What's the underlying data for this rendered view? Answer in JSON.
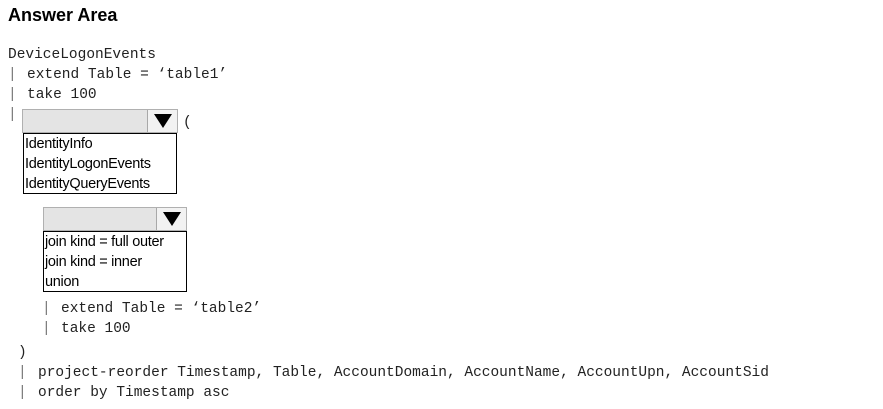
{
  "heading": "Answer Area",
  "query": {
    "source_table": "DeviceLogonEvents",
    "pipe_symbol": "|",
    "line_extend_1": "extend Table = ‘table1’",
    "line_take_1": "take 100",
    "open_paren": "(",
    "line_extend_2": "extend Table = ‘table2’",
    "line_take_2": "take 100",
    "close_paren": ")",
    "line_project": "project-reorder Timestamp, Table, AccountDomain, AccountName, AccountUpn, AccountSid",
    "line_order": "order by Timestamp asc"
  },
  "dropdown_table": {
    "selected": "",
    "arrow_icon": "triangle-down-icon",
    "options": [
      "IdentityInfo",
      "IdentityLogonEvents",
      "IdentityQueryEvents"
    ]
  },
  "dropdown_operator": {
    "selected": "",
    "arrow_icon": "triangle-down-icon",
    "options": [
      "join kind = full outer",
      "join kind = inner",
      "union"
    ]
  }
}
